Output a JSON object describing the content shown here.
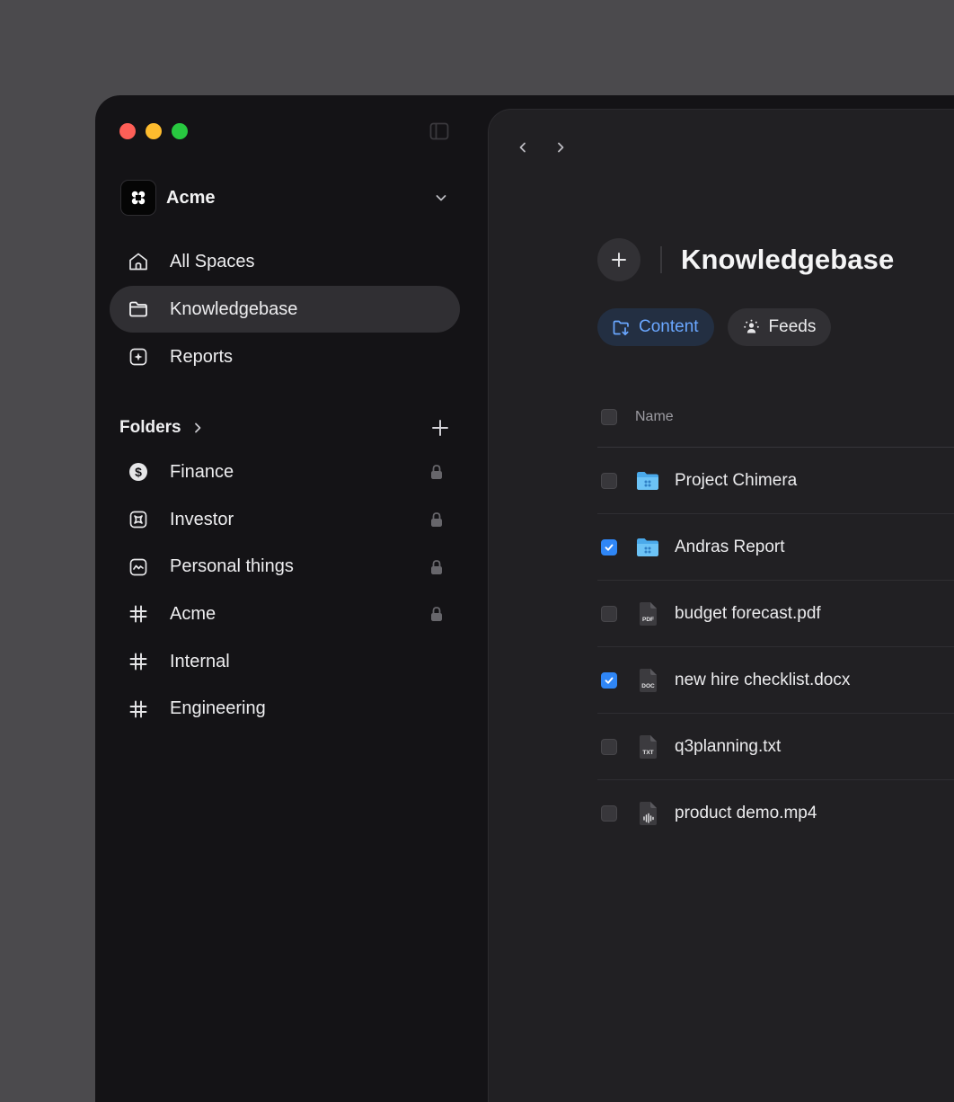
{
  "workspace": {
    "name": "Acme"
  },
  "nav": {
    "items": [
      {
        "label": "All Spaces",
        "icon": "home-icon",
        "active": false
      },
      {
        "label": "Knowledgebase",
        "icon": "folder-icon",
        "active": true
      },
      {
        "label": "Reports",
        "icon": "sparkle-square-icon",
        "active": false
      }
    ]
  },
  "folders": {
    "title": "Folders",
    "items": [
      {
        "label": "Finance",
        "icon": "dollar-circle-icon",
        "locked": true
      },
      {
        "label": "Investor",
        "icon": "clover-square-icon",
        "locked": true
      },
      {
        "label": "Personal things",
        "icon": "chart-square-icon",
        "locked": true
      },
      {
        "label": "Acme",
        "icon": "hash-icon",
        "locked": true
      },
      {
        "label": "Internal",
        "icon": "hash-icon",
        "locked": false
      },
      {
        "label": "Engineering",
        "icon": "hash-icon",
        "locked": false
      }
    ]
  },
  "main": {
    "title": "Knowledgebase",
    "tabs": [
      {
        "label": "Content",
        "icon": "folder-download-icon",
        "active": true
      },
      {
        "label": "Feeds",
        "icon": "broadcast-icon",
        "active": false
      }
    ],
    "table": {
      "header": {
        "name": "Name"
      },
      "rows": [
        {
          "name": "Project Chimera",
          "type": "folder",
          "checked": false
        },
        {
          "name": "Andras Report",
          "type": "folder",
          "checked": true
        },
        {
          "name": "budget forecast.pdf",
          "type": "file",
          "badge": "PDF",
          "checked": false
        },
        {
          "name": "new hire checklist.docx",
          "type": "file",
          "badge": "DOC",
          "checked": true
        },
        {
          "name": "q3planning.txt",
          "type": "file",
          "badge": "TXT",
          "checked": false
        },
        {
          "name": "product demo.mp4",
          "type": "video",
          "checked": false
        }
      ]
    }
  },
  "colors": {
    "accent": "#2f86f6",
    "accent_text": "#6aa7ff",
    "traffic_red": "#fe5f57",
    "traffic_yellow": "#febc2e",
    "traffic_green": "#28c840"
  }
}
